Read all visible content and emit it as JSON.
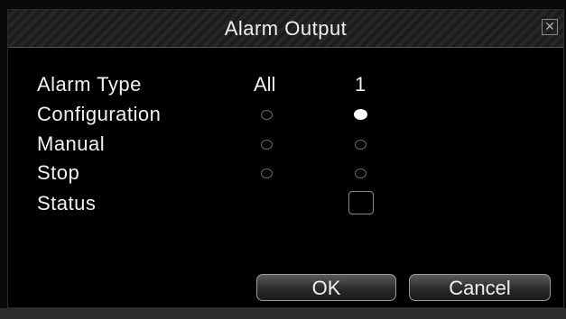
{
  "dialog": {
    "title": "Alarm Output",
    "close_glyph": "✕"
  },
  "columns": {
    "all": "All",
    "one": "1"
  },
  "rows": {
    "alarm_type": "Alarm Type",
    "configuration": "Configuration",
    "manual": "Manual",
    "stop": "Stop",
    "status": "Status"
  },
  "selection": {
    "configuration_all": false,
    "configuration_1": true,
    "manual_all": false,
    "manual_1": false,
    "stop_all": false,
    "stop_1": false,
    "status_1": false
  },
  "buttons": {
    "ok": "OK",
    "cancel": "Cancel"
  },
  "colors": {
    "background": "#000000",
    "text": "#f2f2f2",
    "radio_border": "#6a6a6a"
  },
  "icons": {
    "close": "close-icon"
  }
}
